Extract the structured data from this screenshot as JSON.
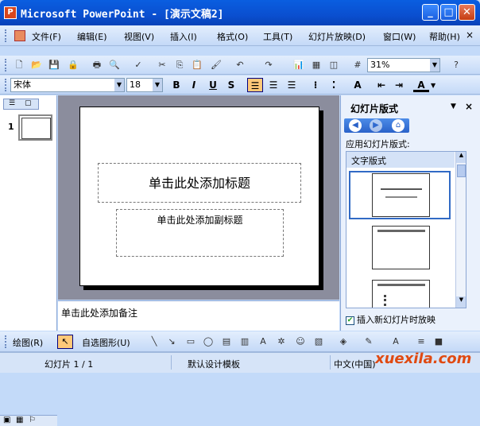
{
  "window": {
    "title": "Microsoft PowerPoint - [演示文稿2]",
    "app_icon": "P",
    "min": "_",
    "max": "□",
    "close": "✕"
  },
  "menu": [
    {
      "label": "文件(F)"
    },
    {
      "label": "编辑(E)"
    },
    {
      "label": "视图(V)"
    },
    {
      "label": "插入(I)"
    },
    {
      "label": "格式(O)"
    },
    {
      "label": "工具(T)"
    },
    {
      "label": "幻灯片放映(D)"
    },
    {
      "label": "窗口(W)"
    },
    {
      "label": "帮助(H)"
    }
  ],
  "menu_close": "×",
  "toolbar": {
    "zoom": "31%"
  },
  "format": {
    "font": "宋体",
    "size": "18",
    "bold": "B",
    "italic": "I",
    "underline": "U",
    "shadow": "S",
    "font_color": "A"
  },
  "slide_pane": {
    "slide_number": "1"
  },
  "slide": {
    "title_placeholder": "单击此处添加标题",
    "subtitle_placeholder": "单击此处添加副标题"
  },
  "notes": {
    "placeholder": "单击此处添加备注"
  },
  "task_pane": {
    "title": "幻灯片版式",
    "apply_label": "应用幻灯片版式:",
    "group": "文字版式",
    "checkbox_label": "插入新幻灯片时放映",
    "checkbox_checked": true,
    "menu_arrow": "▼",
    "close": "×"
  },
  "drawing": {
    "draw_label": "绘图(R)",
    "autoshapes_label": "自选图形(U)"
  },
  "status": {
    "slide": "幻灯片 1 / 1",
    "design": "默认设计模板",
    "language": "中文(中国)"
  },
  "watermark": "xuexila.com"
}
